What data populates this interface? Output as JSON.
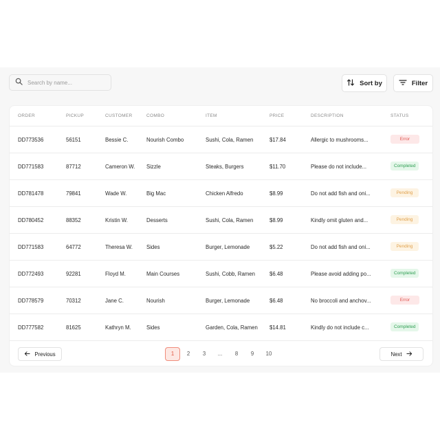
{
  "search": {
    "placeholder": "Search by name..."
  },
  "toolbar": {
    "sort_label": "Sort by",
    "filter_label": "Filter"
  },
  "table": {
    "columns": [
      "ORDER",
      "PICKUP",
      "CUSTOMER",
      "COMBO",
      "ITEM",
      "PRICE",
      "DESCRIPTION",
      "STATUS"
    ],
    "rows": [
      {
        "order": "DD773536",
        "pickup": "56151",
        "customer": "Bessie C.",
        "combo": "Nourish Combo",
        "item": "Sushi, Cola, Ramen",
        "price": "$17.84",
        "description": "Allergic to mushrooms...",
        "status": "Error"
      },
      {
        "order": "DD771583",
        "pickup": "87712",
        "customer": "Cameron W.",
        "combo": "Sizzle",
        "item": "Steaks, Burgers",
        "price": "$11.70",
        "description": "Please do not include...",
        "status": "Completed"
      },
      {
        "order": "DD781478",
        "pickup": "79841",
        "customer": "Wade W.",
        "combo": "Big Mac",
        "item": "Chicken Alfredo",
        "price": "$8.99",
        "description": "Do not add fish and oni...",
        "status": "Pending"
      },
      {
        "order": "DD780452",
        "pickup": "88352",
        "customer": "Kristin W.",
        "combo": "Desserts",
        "item": "Sushi, Cola, Ramen",
        "price": "$8.99",
        "description": "Kindly omit gluten and...",
        "status": "Pending"
      },
      {
        "order": "DD771583",
        "pickup": "64772",
        "customer": "Theresa W.",
        "combo": "Sides",
        "item": "Burger, Lemonade",
        "price": "$5.22",
        "description": "Do not add fish and oni...",
        "status": "Pending"
      },
      {
        "order": "DD772493",
        "pickup": "92281",
        "customer": "Floyd M.",
        "combo": "Main Courses",
        "item": "Sushi, Cobb, Ramen",
        "price": "$6.48",
        "description": "Please avoid adding po...",
        "status": "Completed"
      },
      {
        "order": "DD778579",
        "pickup": "70312",
        "customer": "Jane C.",
        "combo": "Nourish",
        "item": "Burger, Lemonade",
        "price": "$6.48",
        "description": "No broccoli and anchov...",
        "status": "Error"
      },
      {
        "order": "DD777582",
        "pickup": "81625",
        "customer": "Kathryn M.",
        "combo": "Sides",
        "item": "Garden, Cola, Ramen",
        "price": "$14.81",
        "description": "Kindly do not include c...",
        "status": "Completed"
      }
    ]
  },
  "pagination": {
    "previous_label": "Previous",
    "next_label": "Next",
    "pages": [
      "1",
      "2",
      "3",
      "...",
      "8",
      "9",
      "10"
    ],
    "current_page": "1"
  },
  "colors": {
    "error": "#e0554f",
    "completed": "#2e9e52",
    "pending": "#e0a04c",
    "active_page": "#f08b7a"
  },
  "icons": {
    "search": "search-icon",
    "sort": "sort-arrows-icon",
    "filter": "filter-lines-icon",
    "previous": "arrow-left-icon",
    "next": "arrow-right-icon"
  }
}
